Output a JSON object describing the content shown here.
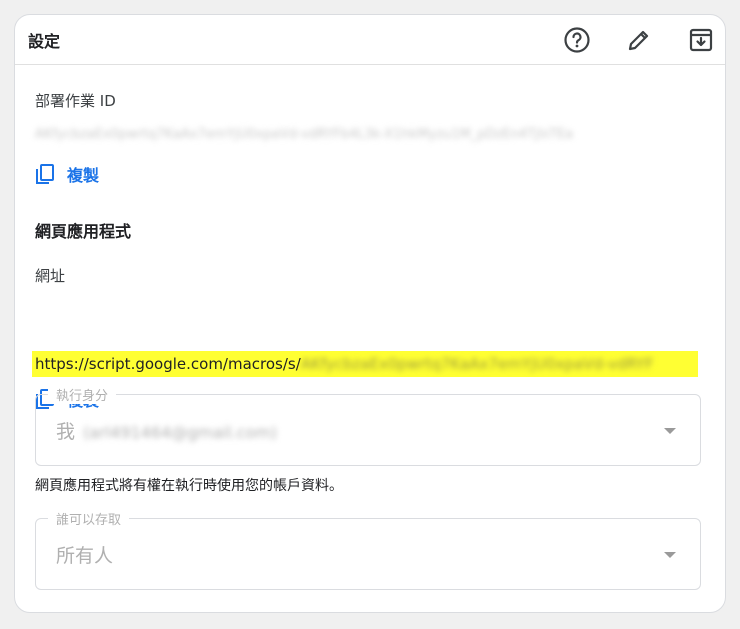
{
  "header": {
    "title": "設定",
    "help_icon": "help-circle-icon",
    "edit_icon": "pencil-icon",
    "archive_icon": "archive-download-icon"
  },
  "deployment": {
    "label": "部署作業 ID",
    "id_value": "AKfycbzaEx0pwrtq7KaAx7emYjU0xpaVd-vdRYFb4L3k-X1hkMyzu1M_pDzEn4TjlsTEa",
    "copy_label": "複製",
    "copy_icon": "copy-icon"
  },
  "webapp": {
    "section_title": "網頁應用程式",
    "url_label": "網址",
    "url_prefix": "https://script.google.com/macros/s/",
    "url_blurred": "AKfycbzaEx0pwrtq7KaAx7emYjU0xpaVd-vdRYF",
    "copy_label": "複製",
    "copy_icon": "copy-icon"
  },
  "execute_as": {
    "legend": "執行身分",
    "value": "我",
    "email": "(arl491464@gmail.com)"
  },
  "note": "網頁應用程式將有權在執行時使用您的帳戶資料。",
  "access": {
    "legend": "誰可以存取",
    "value": "所有人"
  },
  "colors": {
    "accent": "#1a73e8",
    "highlight": "#ffff33"
  }
}
